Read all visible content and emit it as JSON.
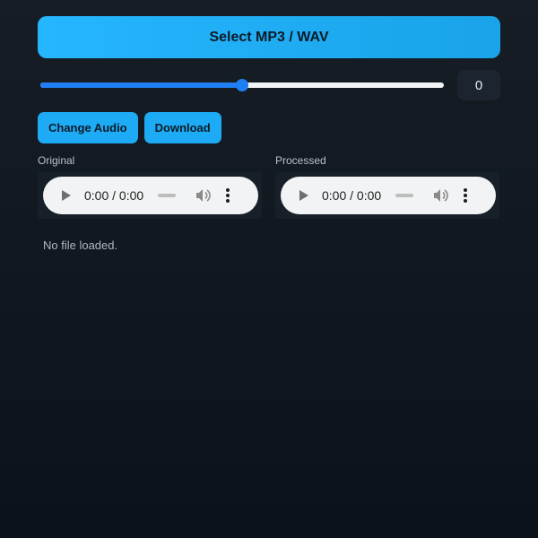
{
  "select_button": {
    "label": "Select MP3 / WAV"
  },
  "slider": {
    "fraction": 0.5,
    "value_display": "0"
  },
  "buttons": {
    "change_audio": "Change Audio",
    "download": "Download"
  },
  "players": [
    {
      "label": "Original",
      "time": "0:00 / 0:00"
    },
    {
      "label": "Processed",
      "time": "0:00 / 0:00"
    }
  ],
  "status": {
    "text": "No file loaded."
  },
  "colors": {
    "accent": "#25b6ff",
    "slider": "#1f7ef2",
    "background": "#111820"
  },
  "icons": {
    "play": "play-icon",
    "volume": "volume-icon",
    "menu": "more-vert-icon"
  }
}
